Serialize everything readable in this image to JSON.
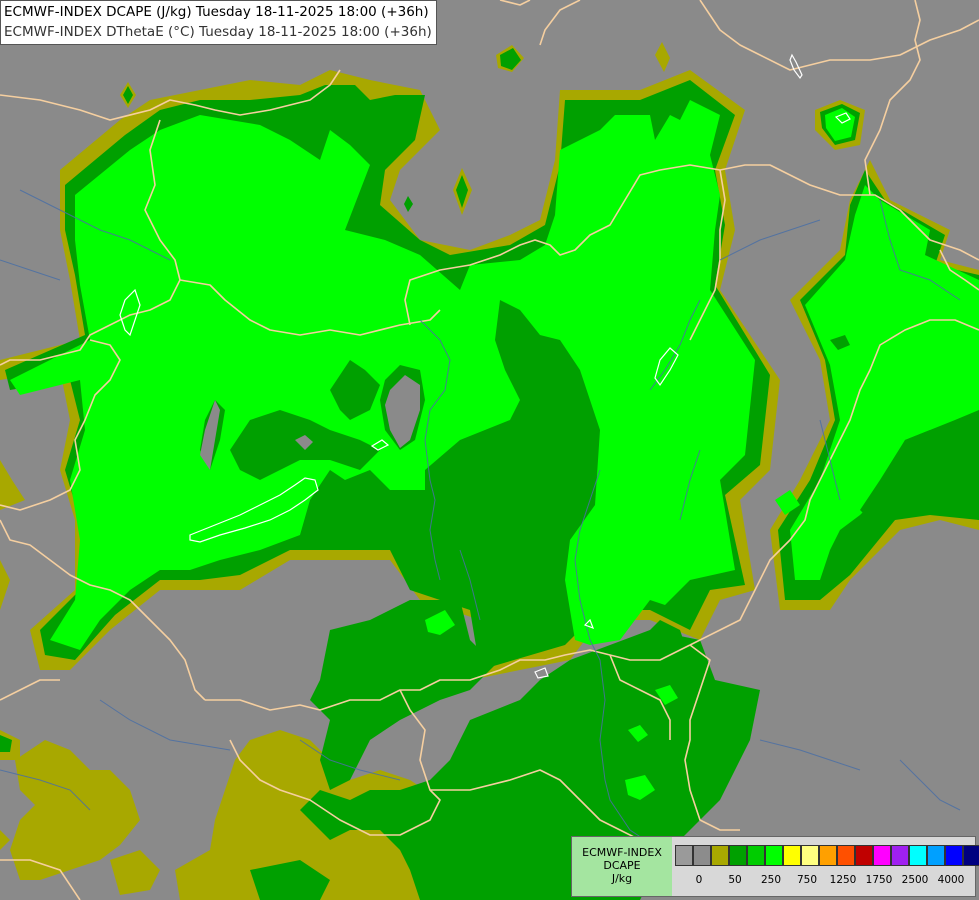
{
  "title": {
    "line1": "ECMWF-INDEX DCAPE (J/kg) Tuesday 18-11-2025 18:00 (+36h)",
    "line2": "ECMWF-INDEX DThetaE (°C) Tuesday 18-11-2025 18:00 (+36h)"
  },
  "legend": {
    "label_line1": "ECMWF-INDEX",
    "label_line2": "DCAPE",
    "label_line3": "J/kg",
    "colors": [
      "#9a9a9a",
      "#8c8c8c",
      "#a8a800",
      "#00a000",
      "#00cc00",
      "#00ff00",
      "#ffff00",
      "#ffff80",
      "#ffa000",
      "#ff5000",
      "#c00000",
      "#ff00ff",
      "#a020f0",
      "#00ffff",
      "#00a0ff",
      "#0000ff",
      "#000080"
    ],
    "ticks": [
      "0",
      "50",
      "250",
      "750",
      "1250",
      "1750",
      "2500",
      "4000"
    ]
  },
  "colors": {
    "background": "#8a8a8a",
    "olive": "#a8a800",
    "dark_green": "#00a000",
    "bright_green": "#00ff00",
    "borders": "#f5cfa0",
    "rivers": "#4a6fa5",
    "contour": "#ffffff"
  }
}
